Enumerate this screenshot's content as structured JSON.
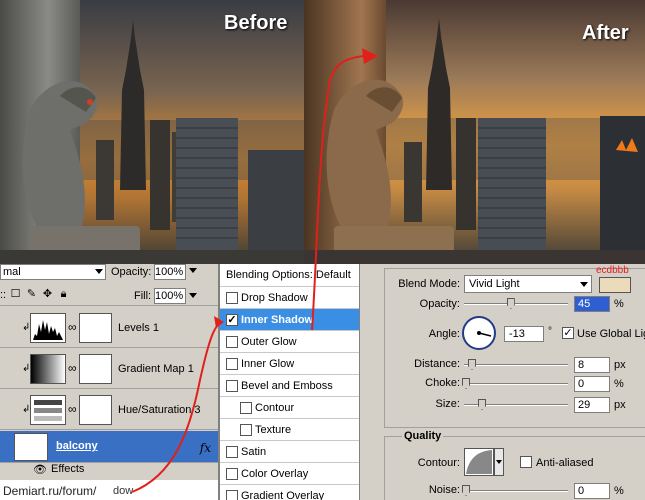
{
  "comparison": {
    "before_label": "Before",
    "after_label": "After"
  },
  "layers_panel": {
    "blend_mode": "mal",
    "opacity_label": "Opacity:",
    "opacity_value": "100%",
    "lock_label": "::",
    "fill_label": "Fill:",
    "fill_value": "100%",
    "layers": [
      {
        "name": "Levels 1"
      },
      {
        "name": "Gradient Map 1"
      },
      {
        "name": "Hue/Saturation 3"
      },
      {
        "name": "balcony",
        "fx": "fx"
      }
    ],
    "effects_label": "Effects",
    "watermark": "Demiart.ru/forum/",
    "watermark_tail": "dow"
  },
  "styles_list": {
    "header": "Blending Options: Default",
    "items": [
      {
        "label": "Drop Shadow",
        "checked": false,
        "indent": false
      },
      {
        "label": "Inner Shadow",
        "checked": true,
        "indent": false,
        "selected": true
      },
      {
        "label": "Outer Glow",
        "checked": false,
        "indent": false
      },
      {
        "label": "Inner Glow",
        "checked": false,
        "indent": false
      },
      {
        "label": "Bevel and Emboss",
        "checked": false,
        "indent": false
      },
      {
        "label": "Contour",
        "checked": false,
        "indent": true
      },
      {
        "label": "Texture",
        "checked": false,
        "indent": true
      },
      {
        "label": "Satin",
        "checked": false,
        "indent": false
      },
      {
        "label": "Color Overlay",
        "checked": false,
        "indent": false
      },
      {
        "label": "Gradient Overlay",
        "checked": false,
        "indent": false
      }
    ],
    "check_mark": "✓"
  },
  "settings": {
    "blend_mode_label": "Blend Mode:",
    "blend_mode_value": "Vivid Light",
    "color_hex_note": "ecdbbb",
    "color": "#ecdbbb",
    "opacity_label": "Opacity:",
    "opacity_value": "45",
    "opacity_fraction": 0.45,
    "opacity_unit": "%",
    "angle_label": "Angle:",
    "angle_value": "-13",
    "angle_unit": "°",
    "use_global_light": "Use Global Light",
    "global_check": "✓",
    "distance_label": "Distance:",
    "distance_value": "8",
    "distance_unit": "px",
    "choke_label": "Choke:",
    "choke_value": "0",
    "choke_unit": "%",
    "size_label": "Size:",
    "size_value": "29",
    "size_unit": "px",
    "quality_title": "Quality",
    "contour_label": "Contour:",
    "anti_aliased": "Anti-aliased",
    "noise_label": "Noise:",
    "noise_value": "0",
    "noise_unit": "%"
  },
  "colors": {
    "selection_blue": "#3a70c4",
    "arrow_red": "#e0201a"
  }
}
